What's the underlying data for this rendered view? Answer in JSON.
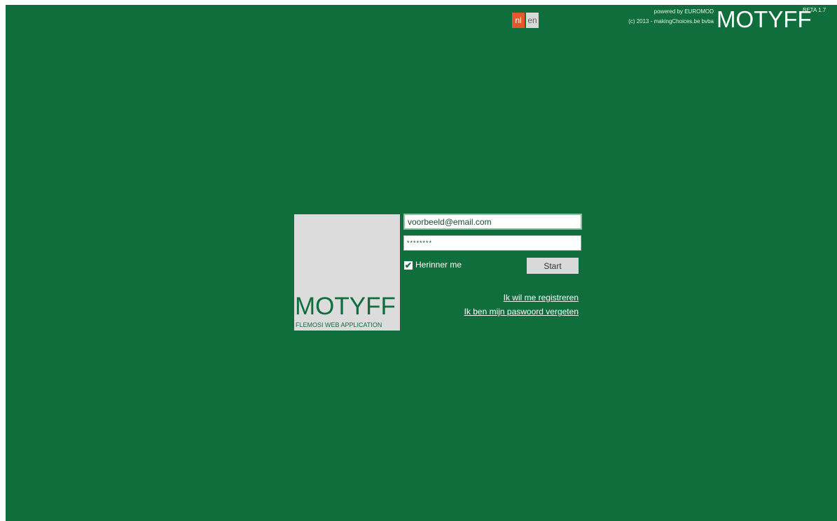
{
  "language": {
    "options": [
      {
        "code": "nl",
        "label": "nl",
        "active": true
      },
      {
        "code": "en",
        "label": "en",
        "active": false
      }
    ]
  },
  "branding": {
    "powered_by": "powered by EUROMOD",
    "copyright": "(c) 2013 - makingChoices.be bvba",
    "app_name": "MOTYFF",
    "version": "BETA 1.7"
  },
  "logo": {
    "title": "MOTYFF",
    "subtitle": "FLEMOSI WEB APPLICATION"
  },
  "login": {
    "email_value": "voorbeeld@email.com",
    "password_value": "********",
    "remember_label": "Herinner me",
    "remember_checked": true,
    "start_label": "Start",
    "register_link": "Ik wil me registreren",
    "forgot_link": "Ik ben mijn paswoord vergeten"
  },
  "colors": {
    "background": "#0f6e3c",
    "lang_active": "#e8572a",
    "logo_box": "#dcdcdc"
  }
}
